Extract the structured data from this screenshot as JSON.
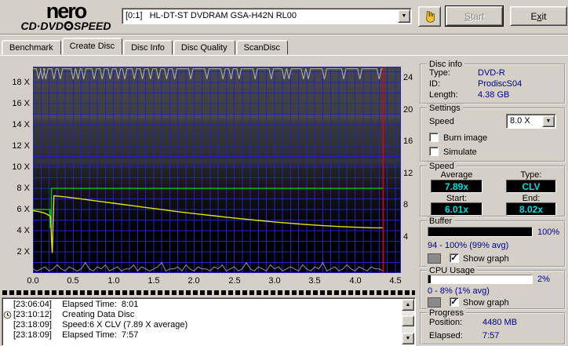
{
  "window": {
    "app": "Nero CD-DVD Speed",
    "bg": "#d4d0c8",
    "accent_navy": "#00008b",
    "lcd_cyan": "#00dcdc"
  },
  "toolbar": {
    "logo": {
      "line1": "nero",
      "line2_left": "CD·DVD",
      "line2_right": "SPEED"
    },
    "drive_combo": {
      "value": "[0:1]   HL-DT-ST DVDRAM GSA-H42N RL00"
    },
    "start_button": {
      "accel": "S",
      "rest": "tart",
      "disabled": true
    },
    "exit_button": {
      "pre": "E",
      "accel": "x",
      "rest": "it"
    }
  },
  "tabs": [
    {
      "label": "Benchmark",
      "active": false
    },
    {
      "label": "Create Disc",
      "active": true
    },
    {
      "label": "Disc Info",
      "active": false
    },
    {
      "label": "Disc Quality",
      "active": false
    },
    {
      "label": "ScanDisc",
      "active": false
    }
  ],
  "chart_data": {
    "type": "line",
    "title": "Create Disc write-speed graph",
    "x_unit": "GB",
    "xlim": [
      0,
      4.57
    ],
    "x_ticks": [
      "0.0",
      "0.5",
      "1.0",
      "1.5",
      "2.0",
      "2.5",
      "3.0",
      "3.5",
      "4.0",
      "4.5"
    ],
    "x_minor_step": 0.1,
    "grid": true,
    "grid_color": "#2121cc",
    "bg_gradient": [
      [
        0,
        "#474747"
      ],
      [
        22,
        "#3f3f3f"
      ],
      [
        24,
        "#4a4a4a"
      ],
      [
        27,
        "#393939"
      ],
      [
        44,
        "#2e2e2e"
      ],
      [
        46,
        "#353535"
      ],
      [
        49,
        "#242424"
      ],
      [
        60,
        "#151515"
      ],
      [
        80,
        "#000000"
      ],
      [
        100,
        "#000000"
      ]
    ],
    "left_axis": {
      "lim": [
        0,
        19.5
      ],
      "grid_step": 1,
      "ticks": [
        {
          "v": 2,
          "label": "2 X"
        },
        {
          "v": 4,
          "label": "4 X"
        },
        {
          "v": 6,
          "label": "6 X"
        },
        {
          "v": 8,
          "label": "8 X"
        },
        {
          "v": 10,
          "label": "10 X"
        },
        {
          "v": 12,
          "label": "12 X"
        },
        {
          "v": 14,
          "label": "14 X"
        },
        {
          "v": 16,
          "label": "16 X"
        },
        {
          "v": 18,
          "label": "18 X"
        }
      ]
    },
    "right_axis": {
      "scale": 0.75,
      "offset": 0.4,
      "ticks": [
        {
          "v": 4,
          "label": "4"
        },
        {
          "v": 8,
          "label": "8"
        },
        {
          "v": 12,
          "label": "12"
        },
        {
          "v": 16,
          "label": "16"
        },
        {
          "v": 20,
          "label": "20"
        },
        {
          "v": 24,
          "label": "24"
        }
      ]
    },
    "series": [
      {
        "name": "set-speed-green",
        "color": "#00cc00",
        "axis": "left",
        "points": [
          [
            0,
            6.0
          ],
          [
            0.21,
            6.0
          ],
          [
            0.215,
            4.3
          ],
          [
            0.225,
            4.3
          ],
          [
            0.23,
            8.0
          ],
          [
            4.35,
            8.0
          ]
        ]
      },
      {
        "name": "write-speed-yellow",
        "color": "#e3e300",
        "axis": "left",
        "points": [
          [
            0,
            5.9
          ],
          [
            0.08,
            5.8
          ],
          [
            0.15,
            5.65
          ],
          [
            0.2,
            5.45
          ],
          [
            0.22,
            5.3
          ],
          [
            0.23,
            3.2
          ],
          [
            0.24,
            1.9
          ],
          [
            0.25,
            4.8
          ],
          [
            0.26,
            7.3
          ],
          [
            0.4,
            7.2
          ],
          [
            0.6,
            7.0
          ],
          [
            0.8,
            6.8
          ],
          [
            1.0,
            6.6
          ],
          [
            1.2,
            6.4
          ],
          [
            1.4,
            6.2
          ],
          [
            1.6,
            6.0
          ],
          [
            1.8,
            5.8
          ],
          [
            2.0,
            5.62
          ],
          [
            2.2,
            5.45
          ],
          [
            2.4,
            5.28
          ],
          [
            2.6,
            5.12
          ],
          [
            2.8,
            4.97
          ],
          [
            3.0,
            4.83
          ],
          [
            3.2,
            4.7
          ],
          [
            3.4,
            4.58
          ],
          [
            3.6,
            4.48
          ],
          [
            3.8,
            4.4
          ],
          [
            4.0,
            4.33
          ],
          [
            4.2,
            4.28
          ],
          [
            4.35,
            4.27
          ]
        ]
      }
    ],
    "buffer_line": {
      "name": "buffer-gray-top",
      "color": "#b4b4b4",
      "unit": "%",
      "baseline_pct": 99,
      "dip_pct": 94,
      "dip_halfwidth": 0.028,
      "end_x": 4.35,
      "dips": [
        0.07,
        0.12,
        0.16,
        0.26,
        0.34,
        0.5,
        0.56,
        0.63,
        0.76,
        0.86,
        0.96,
        1.06,
        1.14,
        1.26,
        1.36,
        1.46,
        1.56,
        1.66,
        1.76,
        1.96,
        2.16,
        2.36,
        2.46,
        2.56,
        2.76,
        2.96,
        3.12,
        3.18,
        3.36,
        3.42,
        3.62,
        3.86,
        4.06,
        4.3
      ]
    },
    "cpu_line": {
      "name": "cpu-gray-bottom",
      "color": "#969696",
      "unit": "%",
      "x_step": 0.05,
      "values_pct": [
        2,
        1,
        2,
        3,
        1,
        2,
        4,
        2,
        1,
        3,
        2,
        1,
        2,
        5,
        2,
        1,
        3,
        2,
        4,
        1,
        2,
        3,
        1,
        2,
        2,
        4,
        1,
        3,
        2,
        1,
        2,
        3,
        5,
        1,
        2,
        2,
        3,
        1,
        4,
        2,
        1,
        3,
        2,
        2,
        1,
        3,
        2,
        4,
        1,
        2,
        3,
        1,
        2,
        5,
        2,
        1,
        3,
        2,
        1,
        4,
        2,
        3,
        1,
        2,
        3,
        2,
        1,
        4,
        2,
        1,
        3,
        2,
        5,
        1,
        2,
        3,
        1,
        2,
        4,
        2,
        1,
        3,
        2,
        1,
        3,
        2,
        2,
        1
      ]
    },
    "marker": {
      "name": "end-position-red",
      "color": "#dc0000",
      "x": 4.35
    }
  },
  "disc_info": {
    "title": "Disc info",
    "rows": [
      {
        "label": "Type:",
        "value": "DVD-R"
      },
      {
        "label": "ID:",
        "value": "ProdiscS04"
      },
      {
        "label": "Length:",
        "value": "4.38 GB"
      }
    ]
  },
  "settings": {
    "title": "Settings",
    "speed_label": "Speed",
    "speed_value": "8.0 X",
    "checkboxes": [
      {
        "label": "Burn image",
        "checked": false
      },
      {
        "label": "Simulate",
        "checked": false
      }
    ]
  },
  "speed": {
    "title": "Speed",
    "cells": [
      {
        "label": "Average",
        "value": "7.89x"
      },
      {
        "label": "Type:",
        "value": "CLV"
      },
      {
        "label": "Start:",
        "value": "6.01x"
      },
      {
        "label": "End:",
        "value": "8.02x"
      }
    ]
  },
  "buffer": {
    "title": "Buffer",
    "percent": 100,
    "percent_label": "100%",
    "range_label": "94 - 100% (99% avg)",
    "show_graph_label": "Show graph",
    "checked": true,
    "check_glyph": "✓",
    "swatch_color": "#8a8a8a"
  },
  "cpu": {
    "title": "CPU Usage",
    "percent": 2,
    "percent_label": "2%",
    "range_label": "0 - 8% (1% avg)",
    "show_graph_label": "Show graph",
    "checked": true,
    "check_glyph": "✓",
    "swatch_color": "#8a8a8a"
  },
  "progress": {
    "title": "Progress",
    "rows": [
      {
        "label": "Position:",
        "value": "4480 MB"
      },
      {
        "label": "Elapsed:",
        "value": "7:57"
      }
    ]
  },
  "log": {
    "rows": [
      {
        "time": "[23:06:04]",
        "text": "Elapsed Time:  8:01",
        "icon": false
      },
      {
        "time": "[23:10:12]",
        "text": "Creating Data Disc",
        "icon": true
      },
      {
        "time": "[23:18:09]",
        "text": "Speed:6 X CLV (7.89 X average)",
        "icon": false
      },
      {
        "time": "[23:18:09]",
        "text": "Elapsed Time:  7:57",
        "icon": false
      }
    ]
  }
}
